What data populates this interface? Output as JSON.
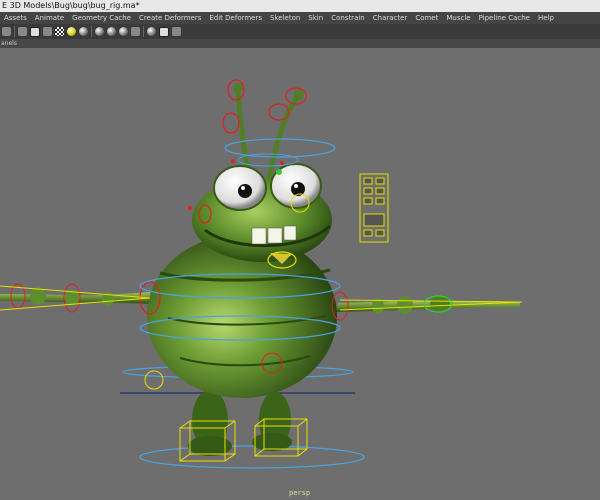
{
  "window": {
    "title": "E 3D Models\\Bug\\bug\\bug_rig.ma*"
  },
  "menubar": {
    "items": [
      "Assets",
      "Animate",
      "Geometry Cache",
      "Create Deformers",
      "Edit Deformers",
      "Skeleton",
      "Skin",
      "Constrain",
      "Character",
      "Comet",
      "Muscle",
      "Pipeline Cache",
      "Help"
    ]
  },
  "panel": {
    "menu_label": "anels"
  },
  "viewport": {
    "camera_label": "persp"
  },
  "colors": {
    "viewport_bg": "#6e6e6e",
    "bug_green": "#5d8f2e",
    "control_red": "#e02020",
    "control_yellow": "#e8e000",
    "control_blue": "#4aa3e0",
    "control_green": "#30d030"
  },
  "toolbar": {
    "icons": [
      "grid-icon",
      "camera-icon",
      "cube-icon",
      "film-icon",
      "checker-icon",
      "light-icon",
      "shaded-sphere-icon",
      "wire-sphere-icon",
      "smooth-sphere-icon",
      "texture-icon",
      "isolate-icon",
      "xray-icon",
      "joint-icon"
    ]
  }
}
